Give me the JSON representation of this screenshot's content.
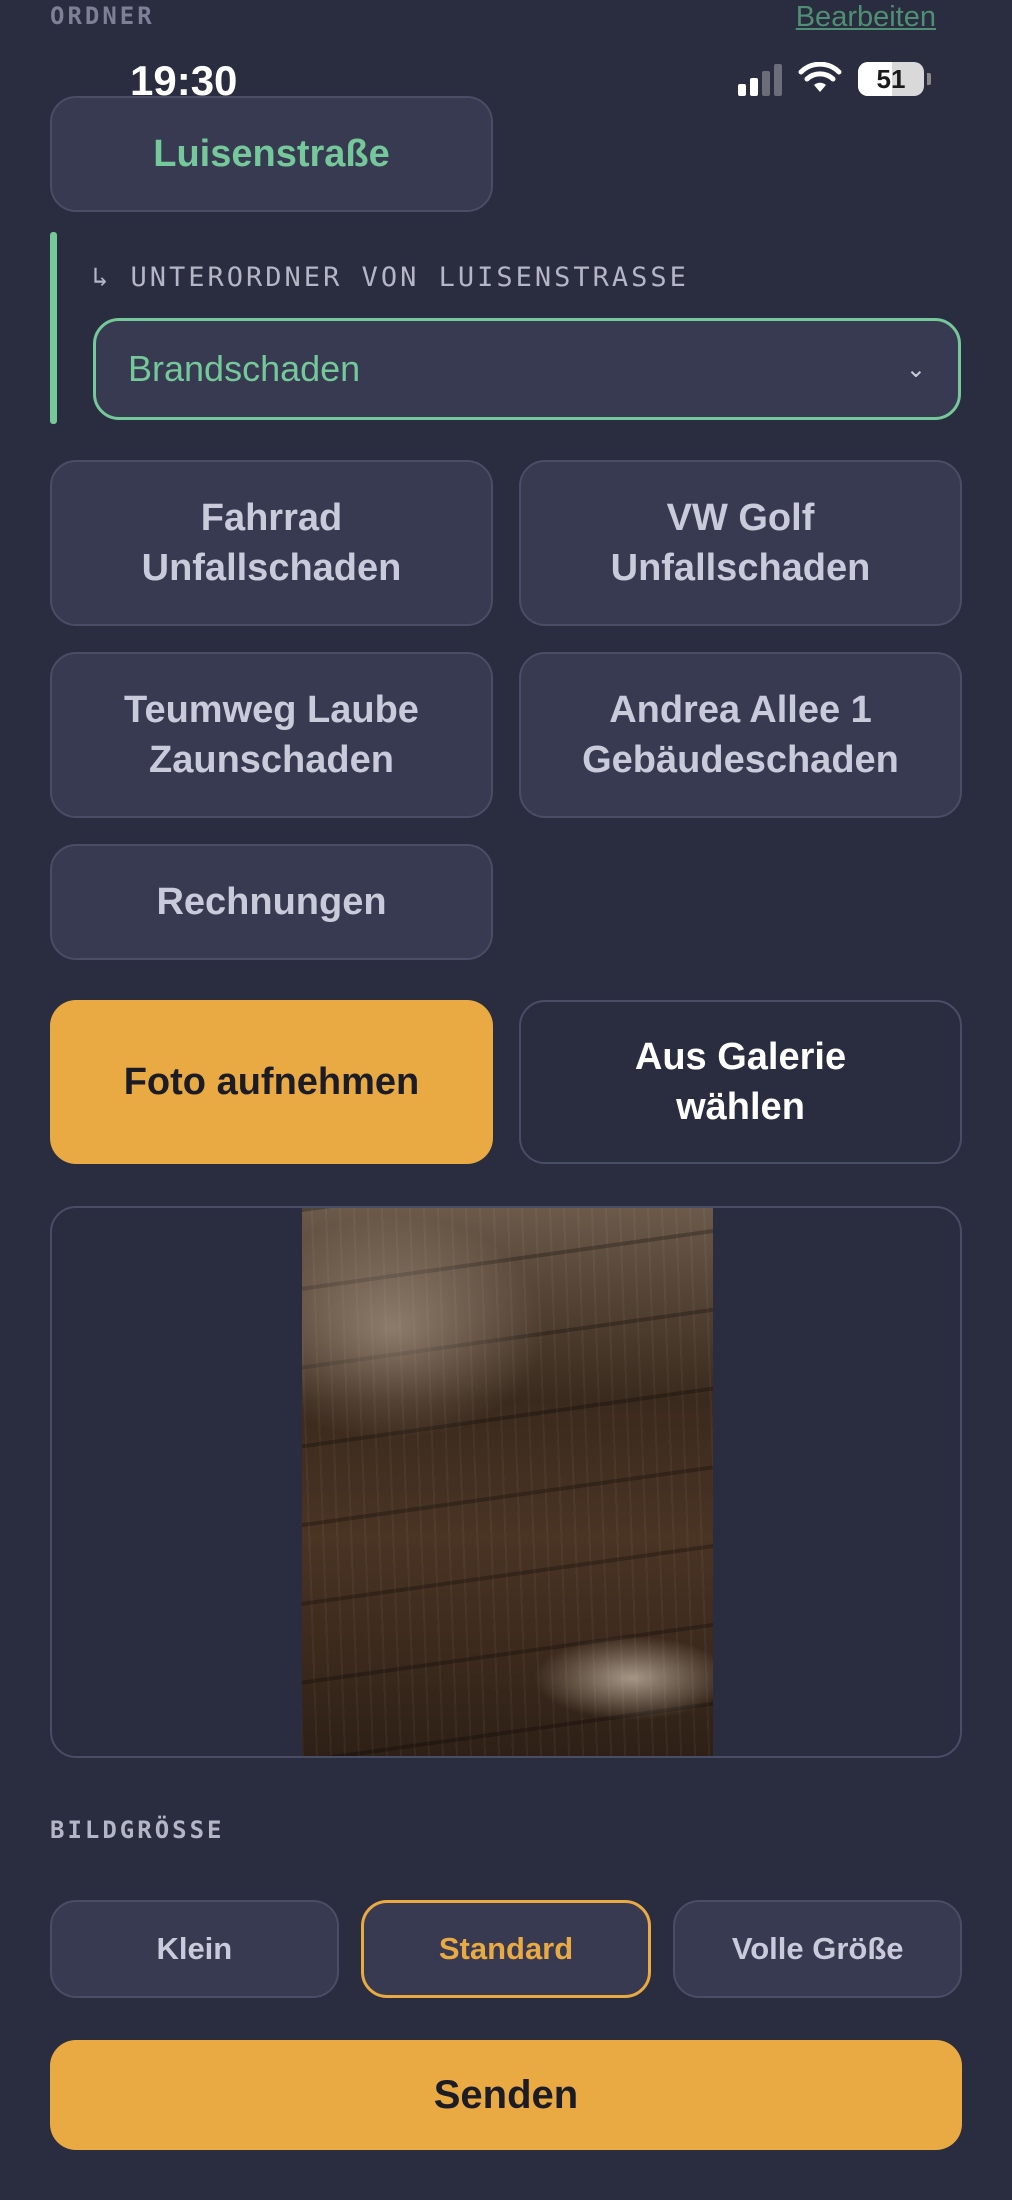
{
  "header": {
    "section_label": "ORDNER",
    "edit_link": "Bearbeiten"
  },
  "status_bar": {
    "time": "19:30",
    "battery": "51",
    "battery_level": 0.51,
    "icons": [
      "signal-icon",
      "wifi-icon",
      "battery-icon"
    ]
  },
  "folders": {
    "active": "Luisenstraße",
    "items": [
      "Fahrrad\nUnfallschaden",
      "VW Golf\nUnfallschaden",
      "Teumweg Laube\nZaunschaden",
      "Andrea Allee 1\nGebäudeschaden",
      "Rechnungen"
    ]
  },
  "subfolder": {
    "label": "↳ UNTERORDNER VON LUISENSTRASSE",
    "selected": "Brandschaden",
    "chevron": "⌄"
  },
  "actions": {
    "take_photo": "Foto aufnehmen",
    "choose_gallery": "Aus Galerie\nwählen"
  },
  "image_size": {
    "label": "BILDGRÖSSE",
    "options": [
      "Klein",
      "Standard",
      "Volle Größe"
    ],
    "selected": "Standard"
  },
  "send_label": "Senden",
  "colors": {
    "background": "#2a2c3f",
    "accent_green": "#74c89a",
    "accent_orange": "#e9a943"
  }
}
